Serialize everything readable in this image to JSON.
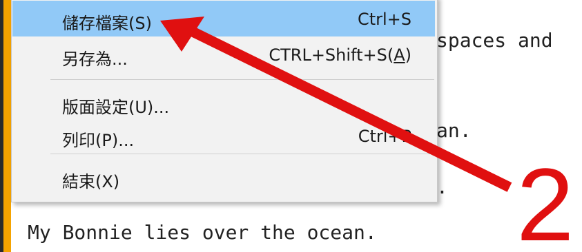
{
  "document": {
    "line_1_fragment": "spaces and",
    "line_2_fragment": "an.",
    "line_3_fragment": ".",
    "line_4": "My Bonnie lies over the ocean."
  },
  "file_menu": {
    "items": [
      {
        "label": "儲存檔案(S)",
        "shortcut": "Ctrl+S",
        "highlighted": true
      },
      {
        "label": "另存為...",
        "shortcut_prefix": "CTRL+Shift+S(",
        "shortcut_key": "A",
        "shortcut_suffix": ")"
      },
      {
        "label": "版面設定(U)..."
      },
      {
        "label": "列印(P)...",
        "shortcut": "Ctrl+P"
      },
      {
        "label": "結束(X)"
      }
    ]
  },
  "annotation": {
    "step_number": "2",
    "color": "#e01010"
  },
  "colors": {
    "highlight": "#91c9f7",
    "menu_background": "#f2f2f2",
    "orange_bar": "#f5a300"
  },
  "icons": [
    "red-annotation-arrow-icon"
  ]
}
